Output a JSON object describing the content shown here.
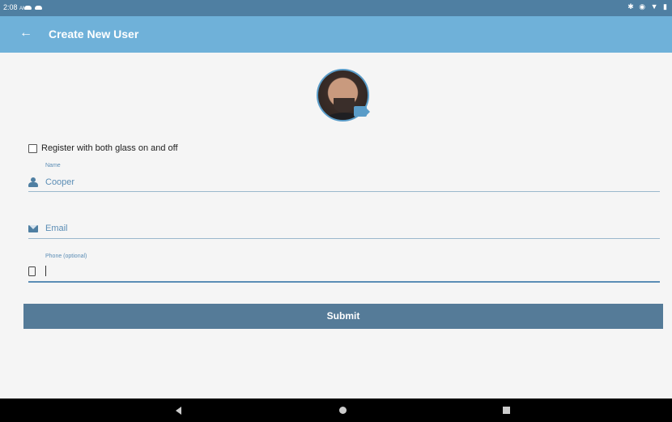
{
  "status_bar": {
    "time": "2:08",
    "ampm": "AM",
    "right_icons": "✱ ◉ ▼ ▮"
  },
  "app_bar": {
    "back_icon": "←",
    "title": "Create New User"
  },
  "avatar": {
    "icon": "camera-icon"
  },
  "checkbox": {
    "label": "Register with both glass on and off",
    "checked": false
  },
  "form": {
    "name": {
      "label": "Name",
      "value": "Cooper",
      "icon": "person-icon"
    },
    "email": {
      "placeholder": "Email",
      "icon": "mail-icon"
    },
    "phone": {
      "label": "Phone (optional)",
      "value": "",
      "icon": "phone-icon"
    }
  },
  "submit": {
    "label": "Submit"
  },
  "colors": {
    "status_bar": "#4f7fa2",
    "app_bar": "#6fb1d9",
    "accent": "#5b8db5",
    "submit": "#557b98"
  }
}
